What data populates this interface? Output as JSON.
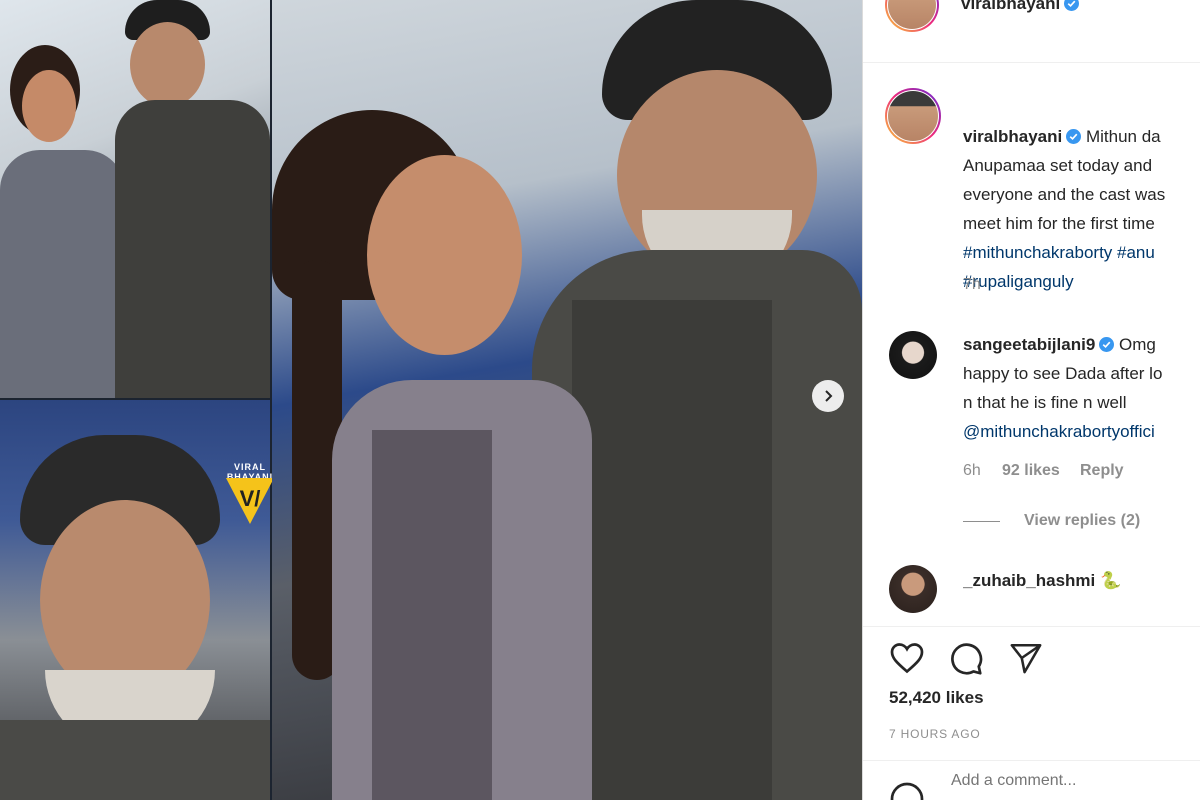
{
  "post": {
    "author": "viralbhayani",
    "watermark": "VIRAL BHAYANI",
    "caption_lines": [
      "Mithun da",
      "Anupamaa set today and",
      "everyone and the cast was",
      "meet him for the first time"
    ],
    "hashtag_lines": [
      "#mithunchakraborty #anu",
      "#rupaliganguly"
    ],
    "caption_time": "7h"
  },
  "comments": [
    {
      "user": "sangeetabijlani9",
      "lines": [
        "Omg",
        "happy to see Dada after lo",
        "n that he is fine n well"
      ],
      "mention": "@mithunchakrabortyoffici",
      "time": "6h",
      "likes": "92 likes",
      "reply": "Reply",
      "view_replies": "View replies (2)"
    },
    {
      "user": "_zuhaib_hashmi",
      "emoji": "🐍"
    }
  ],
  "actions": {
    "like_count": "52,420 likes",
    "time_ago": "7 HOURS AGO",
    "add_comment_placeholder": "Add a comment..."
  },
  "icons": {
    "like": "heart-icon",
    "comment": "comment-icon",
    "share": "paper-plane-icon",
    "verified": "verified-badge-icon",
    "next": "chevron-right-icon",
    "emoji": "smiley-icon"
  },
  "colors": {
    "verified": "#3897f0",
    "hashtag": "#00376b",
    "muted": "#8e8e8e",
    "text": "#262626"
  }
}
